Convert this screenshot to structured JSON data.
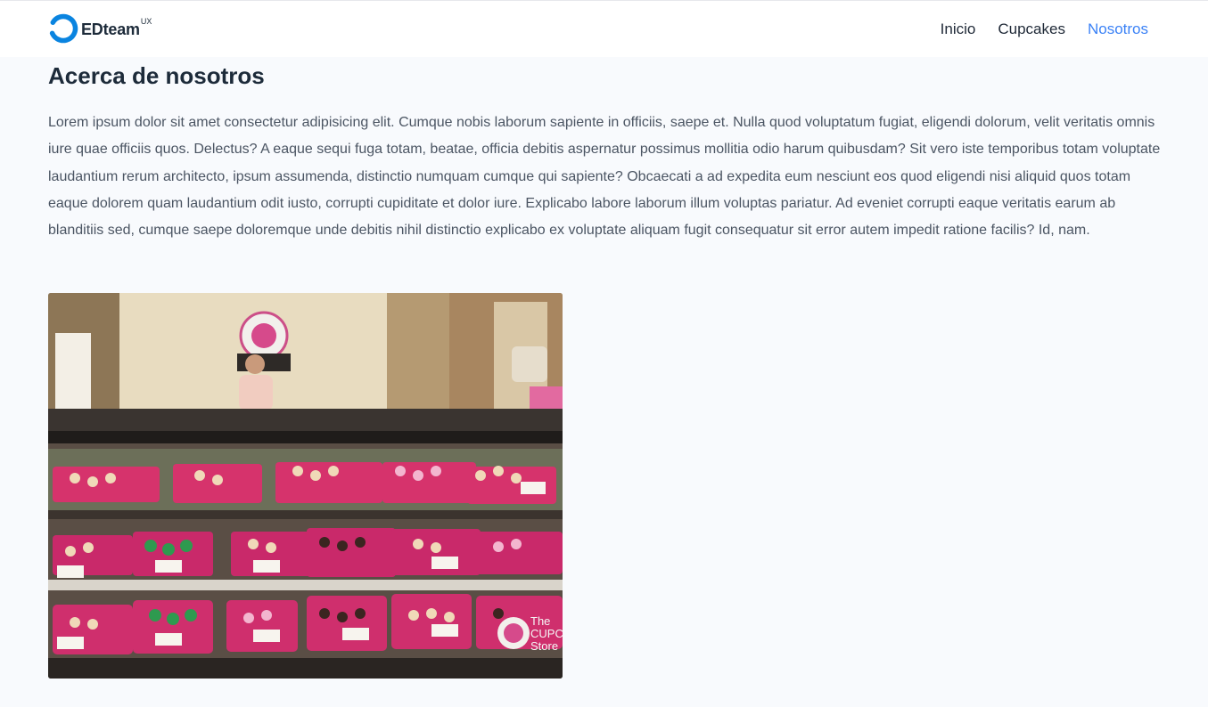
{
  "header": {
    "logo": {
      "text": "EDteam",
      "superscript": "UX"
    },
    "nav": [
      {
        "label": "Inicio",
        "active": false
      },
      {
        "label": "Cupcakes",
        "active": false
      },
      {
        "label": "Nosotros",
        "active": true
      }
    ]
  },
  "main": {
    "title": "Acerca de nosotros",
    "paragraph": "Lorem ipsum dolor sit amet consectetur adipisicing elit. Cumque nobis laborum sapiente in officiis, saepe et. Nulla quod voluptatum fugiat, eligendi dolorum, velit veritatis omnis iure quae officiis quos. Delectus? A eaque sequi fuga totam, beatae, officia debitis aspernatur possimus mollitia odio harum quibusdam? Sit vero iste temporibus totam voluptate laudantium rerum architecto, ipsum assumenda, distinctio numquam cumque qui sapiente? Obcaecati a ad expedita eum nesciunt eos quod eligendi nisi aliquid quos totam eaque dolorem quam laudantium odit iusto, corrupti cupiditate et dolor iure. Explicabo labore laborum illum voluptas pariatur. Ad eveniet corrupti eaque veritatis earum ab blanditiis sed, cumque saepe doloremque unde debitis nihil distinctio explicabo ex voluptate aliquam fugit consequatur sit error autem impedit ratione facilis? Id, nam.",
    "photo": {
      "watermark": [
        "The",
        "CUPCA",
        "Store"
      ]
    }
  },
  "colors": {
    "accent": "#3b82f6",
    "logo_ring": "#0a84e0",
    "text_dark": "#1d2b3a",
    "text_body": "#4b5563",
    "page_bg": "#f8fafd",
    "tray_pink": "#d6336c"
  }
}
